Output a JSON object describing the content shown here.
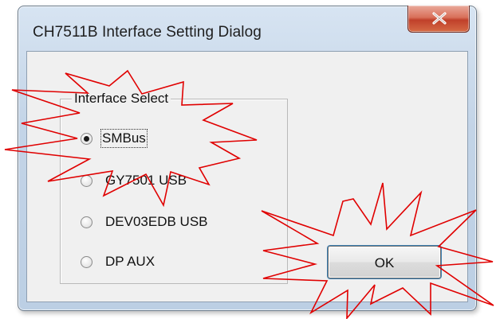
{
  "window": {
    "title": "CH7511B Interface Setting Dialog",
    "close_label": "close"
  },
  "group": {
    "legend": "Interface Select",
    "options": [
      {
        "label": "SMBus",
        "checked": true
      },
      {
        "label": "GY7501 USB",
        "checked": false
      },
      {
        "label": "DEV03EDB USB",
        "checked": false
      },
      {
        "label": "DP AUX",
        "checked": false
      }
    ]
  },
  "buttons": {
    "ok_label": "OK"
  },
  "colors": {
    "annotation_star": "#e00000",
    "close_button": "#c0402a",
    "client_bg": "#f0f0f0"
  },
  "icons": {
    "close": "close-icon",
    "annotation": "starburst-highlight"
  }
}
